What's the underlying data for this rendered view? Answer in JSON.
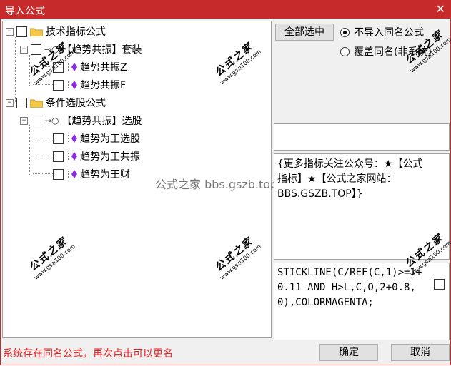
{
  "window": {
    "title": "导入公式",
    "close_glyph": "✕"
  },
  "tree": {
    "root1": {
      "label": "技术指标公式"
    },
    "r1_set": {
      "label": "【趋势共振】套装"
    },
    "r1_item1": {
      "label": "趋势共振Z"
    },
    "r1_item2": {
      "label": "趋势共振F"
    },
    "root2": {
      "label": "条件选股公式"
    },
    "r2_set": {
      "label": "【趋势共振】选股"
    },
    "r2_item1": {
      "label": "趋势为王选股"
    },
    "r2_item2": {
      "label": "趋势为王共振"
    },
    "r2_item3": {
      "label": "趋势为王财"
    }
  },
  "watermark": {
    "text": "公式之家",
    "url": "www.gszj100.com",
    "center": "公式之家 bbs.gszb.top"
  },
  "controls": {
    "select_all": "全部选中",
    "radio_skip": "不导入同名公式",
    "radio_overwrite": "覆盖同名(非系统)",
    "ok": "确定",
    "cancel": "取消"
  },
  "info_text": "{更多指标关注公众号：★【公式指标】★【公式之家网站：BBS.GSZB.TOP】}",
  "formula_text": "STICKLINE(C/REF(C,1)>=1+0.11 AND H>L,C,O,2+0.8,0),COLORMAGENTA;",
  "status": "系统存在同名公式，再次点击可以更名",
  "colors": {
    "title_bar": "#c62a2a",
    "status": "#e02020",
    "diamond": "#8a2be2"
  }
}
